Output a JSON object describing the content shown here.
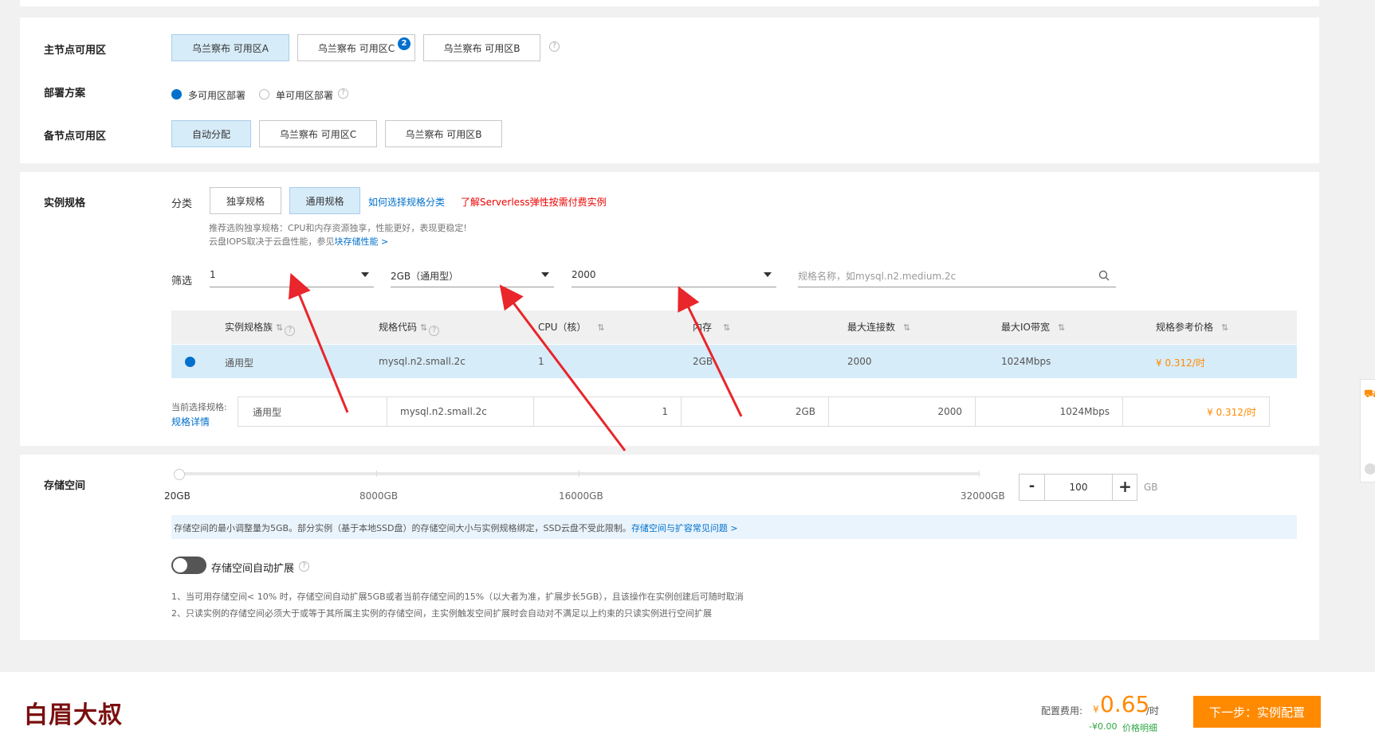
{
  "zone": {
    "main_label": "主节点可用区",
    "main_options": [
      "乌兰察布 可用区A",
      "乌兰察布 可用区C",
      "乌兰察布 可用区B"
    ],
    "main_badge": "2",
    "deploy_label": "部署方案",
    "deploy_options": [
      "多可用区部署",
      "单可用区部署"
    ],
    "backup_label": "备节点可用区",
    "backup_options": [
      "自动分配",
      "乌兰察布 可用区C",
      "乌兰察布 可用区B"
    ]
  },
  "spec": {
    "label": "实例规格",
    "category_label": "分类",
    "categories": [
      "独享规格",
      "通用规格"
    ],
    "how_link": "如何选择规格分类",
    "serverless_link": "了解Serverless弹性按需付费实例",
    "hint1": "推荐选购独享规格：CPU和内存资源独享，性能更好，表现更稳定!",
    "hint2_prefix": "云盘IOPS取决于云盘性能，参见",
    "hint2_link": "块存储性能 >",
    "filter_label": "筛选",
    "filter_cpu": "1",
    "filter_mem": "2GB（通用型）",
    "filter_conn": "2000",
    "search_placeholder": "规格名称，如mysql.n2.medium.2c",
    "table_headers": [
      "实例规格族",
      "规格代码",
      "CPU（核）",
      "内存",
      "最大连接数",
      "最大IO带宽",
      "规格参考价格"
    ],
    "row": {
      "family": "通用型",
      "code": "mysql.n2.small.2c",
      "cpu": "1",
      "memory": "2GB",
      "connections": "2000",
      "io": "1024Mbps",
      "price": "¥ 0.312/时"
    },
    "current_label": "当前选择规格:",
    "detail_link": "规格详情",
    "current": {
      "family": "通用型",
      "code": "mysql.n2.small.2c",
      "cpu": "1",
      "memory": "2GB",
      "connections": "2000",
      "io": "1024Mbps",
      "price": "¥ 0.312/时"
    }
  },
  "storage": {
    "label": "存储空间",
    "ticks": [
      "20GB",
      "8000GB",
      "16000GB",
      "32000GB"
    ],
    "value": "100",
    "unit": "GB",
    "minus": "-",
    "plus": "+",
    "slider_fraction": 0.003,
    "notice_text": "存储空间的最小调整量为5GB。部分实例（基于本地SSD盘）的存储空间大小与实例规格绑定，SSD云盘不受此限制。",
    "notice_link": "存储空间与扩容常见问题 >",
    "auto_label": "存储空间自动扩展",
    "note1": "1、当可用存储空间< 10% 时，存储空间自动扩展5GB或者当前存储空间的15%（以大者为准，扩展步长5GB），且该操作在实例创建后可随时取消",
    "note2": "2、只读实例的存储空间必须大于或等于其所属主实例的存储空间，主实例触发空间扩展时会自动对不满足以上约束的只读实例进行空间扩展"
  },
  "footer": {
    "logo_text": "白眉大叔",
    "fee_label": "配置费用:",
    "currency": "¥",
    "price": "0.65",
    "per": "/时",
    "discount": "-¥0.00",
    "price_detail_link": "价格明细",
    "next_button": "下一步：实例配置"
  },
  "colors": {
    "accent": "#0070cc",
    "selected_bg": "#d7ecf9",
    "price": "#ff8a00",
    "cta": "#ff8a00",
    "arrow": "#e8262b"
  }
}
